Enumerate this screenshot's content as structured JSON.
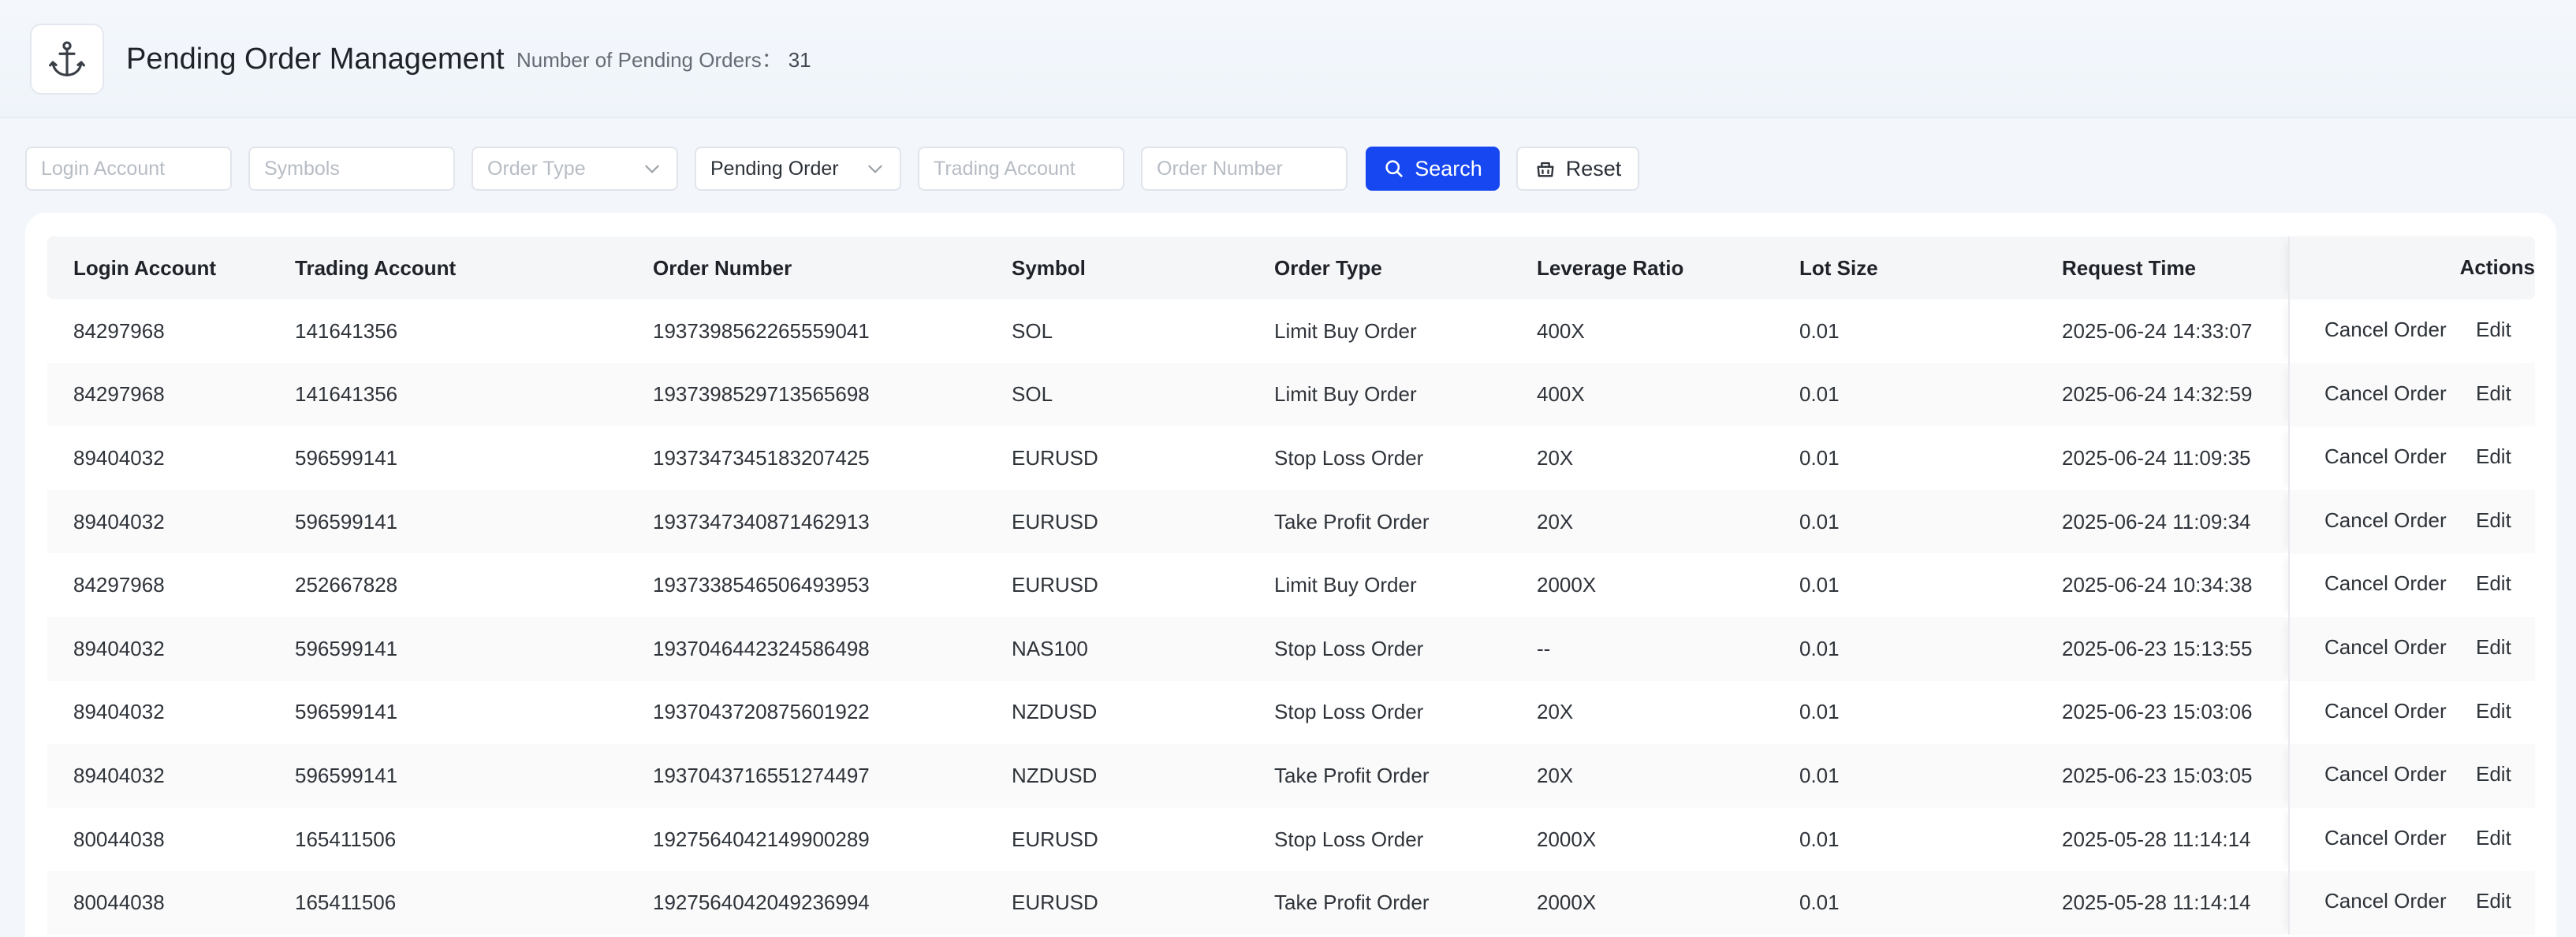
{
  "header": {
    "title": "Pending Order Management",
    "count_label": "Number of Pending Orders：",
    "count_value": "31"
  },
  "filters": {
    "login_account_placeholder": "Login Account",
    "symbols_placeholder": "Symbols",
    "order_type_placeholder": "Order Type",
    "status_value": "Pending Order",
    "trading_account_placeholder": "Trading Account",
    "order_number_placeholder": "Order Number",
    "search_label": "Search",
    "reset_label": "Reset"
  },
  "table": {
    "columns": [
      "Login Account",
      "Trading Account",
      "Order Number",
      "Symbol",
      "Order Type",
      "Leverage Ratio",
      "Lot Size",
      "Request Time",
      "Actions"
    ],
    "action_cancel": "Cancel Order",
    "action_edit": "Edit",
    "rows": [
      [
        "84297968",
        "141641356",
        "1937398562265559041",
        "SOL",
        "Limit Buy Order",
        "400X",
        "0.01",
        "2025-06-24 14:33:07"
      ],
      [
        "84297968",
        "141641356",
        "1937398529713565698",
        "SOL",
        "Limit Buy Order",
        "400X",
        "0.01",
        "2025-06-24 14:32:59"
      ],
      [
        "89404032",
        "596599141",
        "1937347345183207425",
        "EURUSD",
        "Stop Loss Order",
        "20X",
        "0.01",
        "2025-06-24 11:09:35"
      ],
      [
        "89404032",
        "596599141",
        "1937347340871462913",
        "EURUSD",
        "Take Profit Order",
        "20X",
        "0.01",
        "2025-06-24 11:09:34"
      ],
      [
        "84297968",
        "252667828",
        "1937338546506493953",
        "EURUSD",
        "Limit Buy Order",
        "2000X",
        "0.01",
        "2025-06-24 10:34:38"
      ],
      [
        "89404032",
        "596599141",
        "1937046442324586498",
        "NAS100",
        "Stop Loss Order",
        "--",
        "0.01",
        "2025-06-23 15:13:55"
      ],
      [
        "89404032",
        "596599141",
        "1937043720875601922",
        "NZDUSD",
        "Stop Loss Order",
        "20X",
        "0.01",
        "2025-06-23 15:03:06"
      ],
      [
        "89404032",
        "596599141",
        "1937043716551274497",
        "NZDUSD",
        "Take Profit Order",
        "20X",
        "0.01",
        "2025-06-23 15:03:05"
      ],
      [
        "80044038",
        "165411506",
        "1927564042149900289",
        "EURUSD",
        "Stop Loss Order",
        "2000X",
        "0.01",
        "2025-05-28 11:14:14"
      ],
      [
        "80044038",
        "165411506",
        "1927564042049236994",
        "EURUSD",
        "Take Profit Order",
        "2000X",
        "0.01",
        "2025-05-28 11:14:14"
      ]
    ]
  }
}
